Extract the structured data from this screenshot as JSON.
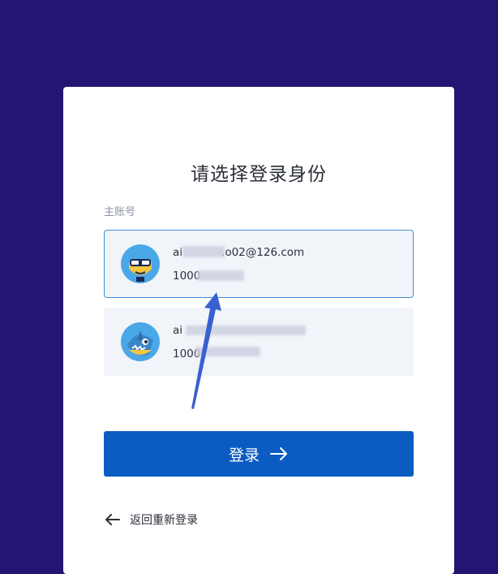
{
  "title": "请选择登录身份",
  "section_label": "主账号",
  "accounts": [
    {
      "email": "ai________.o02@126.com",
      "email_prefix": "ai",
      "email_suffix": ".o02@126.com",
      "uid_prefix": "1000",
      "selected": true
    },
    {
      "email_prefix": "ai",
      "uid_prefix": "1000",
      "selected": false
    }
  ],
  "login_button": {
    "label": "登录"
  },
  "back_link": {
    "label": "返回重新登录"
  },
  "colors": {
    "background": "#241574",
    "card": "#ffffff",
    "button": "#0b5cc2",
    "selected_border": "#3d8ed8",
    "annotation_arrow": "#3a5fd1"
  },
  "icons": {
    "login_arrow": "arrow-right-icon",
    "back_arrow": "arrow-left-icon"
  }
}
